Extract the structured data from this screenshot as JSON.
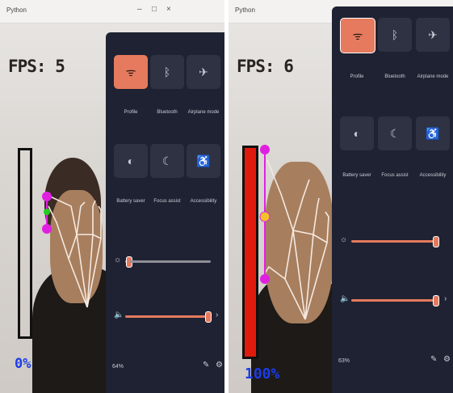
{
  "left": {
    "window_title": "Python",
    "fps": "FPS: 5",
    "volume_percent_label": "0%",
    "volume_level": 0.0,
    "quick_settings": {
      "tiles": [
        {
          "label": "Profile",
          "icon": "wifi-icon",
          "active": true
        },
        {
          "label": "Bluetooth",
          "icon": "bluetooth-icon",
          "active": false
        },
        {
          "label": "Airplane mode",
          "icon": "airplane-icon",
          "active": false
        },
        {
          "label": "Battery saver",
          "icon": "battery-saver-icon",
          "active": false
        },
        {
          "label": "Focus assist",
          "icon": "moon-icon",
          "active": false
        },
        {
          "label": "Accessibility",
          "icon": "accessibility-icon",
          "active": false
        }
      ],
      "battery": "64%"
    }
  },
  "right": {
    "window_title": "Python",
    "fps": "FPS: 6",
    "volume_percent_label": "100%",
    "volume_level": 1.0,
    "quick_settings": {
      "tiles": [
        {
          "label": "Profile",
          "icon": "wifi-icon",
          "active": true
        },
        {
          "label": "Bluetooth",
          "icon": "bluetooth-icon",
          "active": false
        },
        {
          "label": "Airplane mode",
          "icon": "airplane-icon",
          "active": false
        },
        {
          "label": "Battery saver",
          "icon": "battery-saver-icon",
          "active": false
        },
        {
          "label": "Focus assist",
          "icon": "moon-icon",
          "active": false
        },
        {
          "label": "Accessibility",
          "icon": "accessibility-icon",
          "active": false
        }
      ],
      "battery": "63%"
    }
  }
}
